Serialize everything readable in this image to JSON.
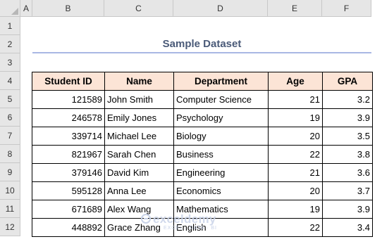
{
  "columns": [
    "A",
    "B",
    "C",
    "D",
    "E",
    "F"
  ],
  "rows": [
    "1",
    "2",
    "3",
    "4",
    "5",
    "6",
    "7",
    "8",
    "9",
    "10",
    "11",
    "12"
  ],
  "title": "Sample Dataset",
  "table": {
    "headers": [
      "Student ID",
      "Name",
      "Department",
      "Age",
      "GPA"
    ],
    "rows": [
      [
        "121589",
        "John Smith",
        "Computer Science",
        "21",
        "3.2"
      ],
      [
        "246578",
        "Emily Jones",
        "Psychology",
        "19",
        "3.9"
      ],
      [
        "339714",
        "Michael Lee",
        "Biology",
        "20",
        "3.5"
      ],
      [
        "821967",
        "Sarah Chen",
        "Business",
        "22",
        "3.8"
      ],
      [
        "379146",
        "David Kim",
        "Engineering",
        "21",
        "3.6"
      ],
      [
        "595128",
        "Anna Lee",
        "Economics",
        "20",
        "3.7"
      ],
      [
        "671689",
        "Alex Wang",
        "Mathematics",
        "19",
        "3.9"
      ],
      [
        "448892",
        "Grace Zhang",
        "English",
        "22",
        "3.4"
      ]
    ]
  },
  "watermark": {
    "name": "exceldemy",
    "tagline": "EXCEL · DATA · BI"
  },
  "colors": {
    "header_fill": "#fce4d6",
    "title_color": "#4a5a78",
    "title_line": "#a9b7e4"
  }
}
